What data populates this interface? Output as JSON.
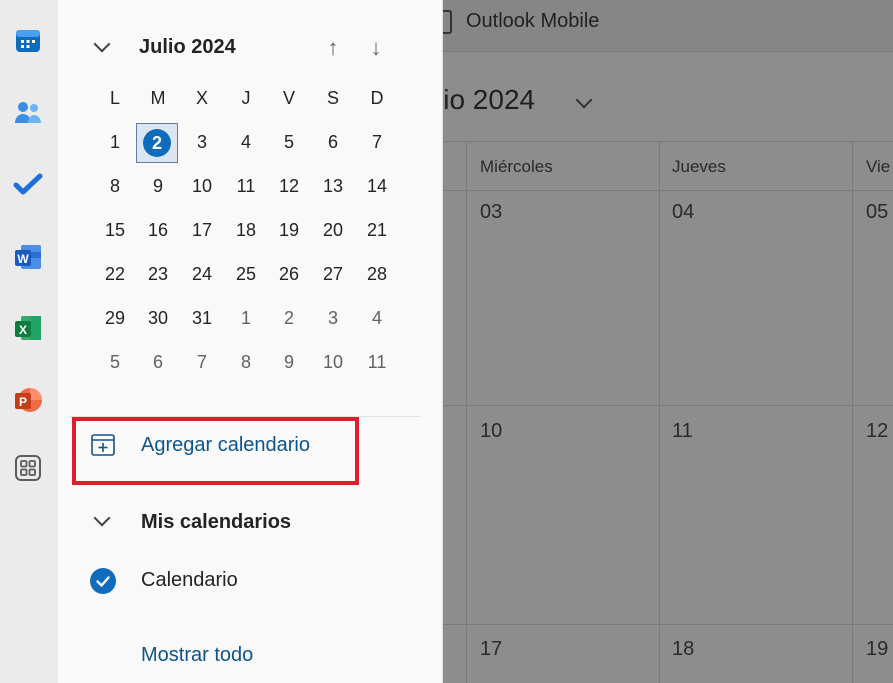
{
  "background": {
    "toolbar_title": "Outlook Mobile",
    "month_title": "lio 2024",
    "day_names": [
      "Miércoles",
      "Jueves",
      "Vie"
    ],
    "dates_row1": [
      "03",
      "04",
      "05"
    ],
    "dates_row2": [
      "10",
      "11",
      "12"
    ],
    "dates_row3": [
      "17",
      "18",
      "19"
    ]
  },
  "app_rail": {
    "icons": [
      "calendar-icon",
      "people-icon",
      "todo-icon",
      "word-icon",
      "excel-icon",
      "powerpoint-icon",
      "apps-icon"
    ]
  },
  "mini_calendar": {
    "month": "Julio 2024",
    "weekdays": [
      "L",
      "M",
      "X",
      "J",
      "V",
      "S",
      "D"
    ],
    "weeks": [
      [
        "1",
        "2",
        "3",
        "4",
        "5",
        "6",
        "7"
      ],
      [
        "8",
        "9",
        "10",
        "11",
        "12",
        "13",
        "14"
      ],
      [
        "15",
        "16",
        "17",
        "18",
        "19",
        "20",
        "21"
      ],
      [
        "22",
        "23",
        "24",
        "25",
        "26",
        "27",
        "28"
      ],
      [
        "29",
        "30",
        "31",
        "1",
        "2",
        "3",
        "4"
      ],
      [
        "5",
        "6",
        "7",
        "8",
        "9",
        "10",
        "11"
      ]
    ],
    "selected_day": "2"
  },
  "add_calendar": {
    "label": "Agregar calendario"
  },
  "my_calendars": {
    "title": "Mis calendarios",
    "items": [
      {
        "label": "Calendario"
      }
    ]
  },
  "show_all": "Mostrar todo",
  "colors": {
    "accent": "#0f6cbd",
    "highlight_border": "#e01e2b",
    "link": "#0f548c"
  }
}
